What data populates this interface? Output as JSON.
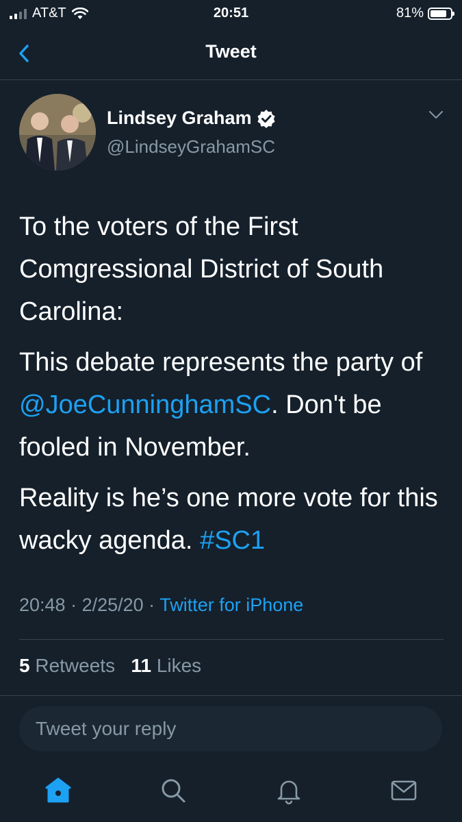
{
  "status_bar": {
    "carrier": "AT&T",
    "time": "20:51",
    "battery": "81%",
    "battery_level": 0.81
  },
  "nav": {
    "title": "Tweet",
    "back_icon": "chevron-left-icon"
  },
  "author": {
    "name": "Lindsey Graham",
    "handle": "@LindseyGrahamSC",
    "verified_icon": "verified-badge-icon"
  },
  "tweet": {
    "para1": "To the voters of the First Comgressional District of South Carolina:",
    "para2_pre": "This debate represents the party of ",
    "para2_mention": "@JoeCunninghamSC",
    "para2_post": ". Don't be fooled in November.",
    "para3_pre": "Reality is he’s one more vote for this wacky agenda. ",
    "para3_hashtag": "#SC1"
  },
  "meta": {
    "time": "20:48",
    "date": "2/25/20",
    "source": "Twitter for iPhone",
    "separator": " · "
  },
  "stats": {
    "retweets_count": "5",
    "retweets_label": "Retweets",
    "likes_count": "11",
    "likes_label": "Likes"
  },
  "reply": {
    "placeholder": "Tweet your reply"
  },
  "tabs": [
    "home-icon",
    "search-icon",
    "notifications-icon",
    "messages-icon"
  ],
  "colors": {
    "background": "#15202b",
    "accent": "#1da1f2",
    "secondary_text": "#8899a6",
    "divider": "#38444d"
  }
}
